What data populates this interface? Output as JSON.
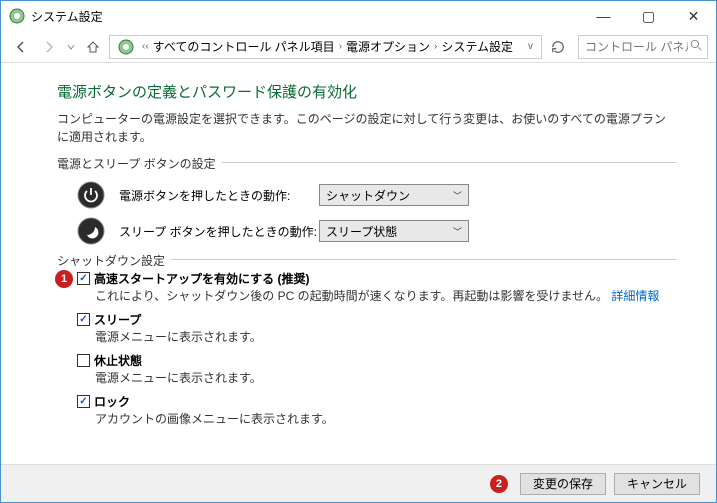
{
  "window": {
    "title": "システム設定"
  },
  "breadcrumb": {
    "levels": [
      "すべてのコントロール パネル項目",
      "電源オプション",
      "システム設定"
    ]
  },
  "search": {
    "placeholder": "コントロール パネル"
  },
  "page": {
    "heading": "電源ボタンの定義とパスワード保護の有効化",
    "subtitle": "コンピューターの電源設定を選択できます。このページの設定に対して行う変更は、お使いのすべての電源プランに適用されます。"
  },
  "power_buttons": {
    "legend": "電源とスリープ ボタンの設定",
    "rows": [
      {
        "label": "電源ボタンを押したときの動作:",
        "value": "シャットダウン"
      },
      {
        "label": "スリープ ボタンを押したときの動作:",
        "value": "スリープ状態"
      }
    ]
  },
  "shutdown": {
    "legend": "シャットダウン設定",
    "items": [
      {
        "checked": true,
        "bold": true,
        "label": "高速スタートアップを有効にする (推奨)",
        "desc": "これにより、シャットダウン後の PC の起動時間が速くなります。再起動は影響を受けません。",
        "link": "詳細情報"
      },
      {
        "checked": true,
        "bold": true,
        "label": "スリープ",
        "desc": "電源メニューに表示されます。"
      },
      {
        "checked": false,
        "bold": true,
        "label": "休止状態",
        "desc": "電源メニューに表示されます。"
      },
      {
        "checked": true,
        "bold": true,
        "label": "ロック",
        "desc": "アカウントの画像メニューに表示されます。"
      }
    ]
  },
  "annotations": {
    "n1": "1",
    "n2": "2"
  },
  "footer": {
    "save": "変更の保存",
    "cancel": "キャンセル"
  }
}
